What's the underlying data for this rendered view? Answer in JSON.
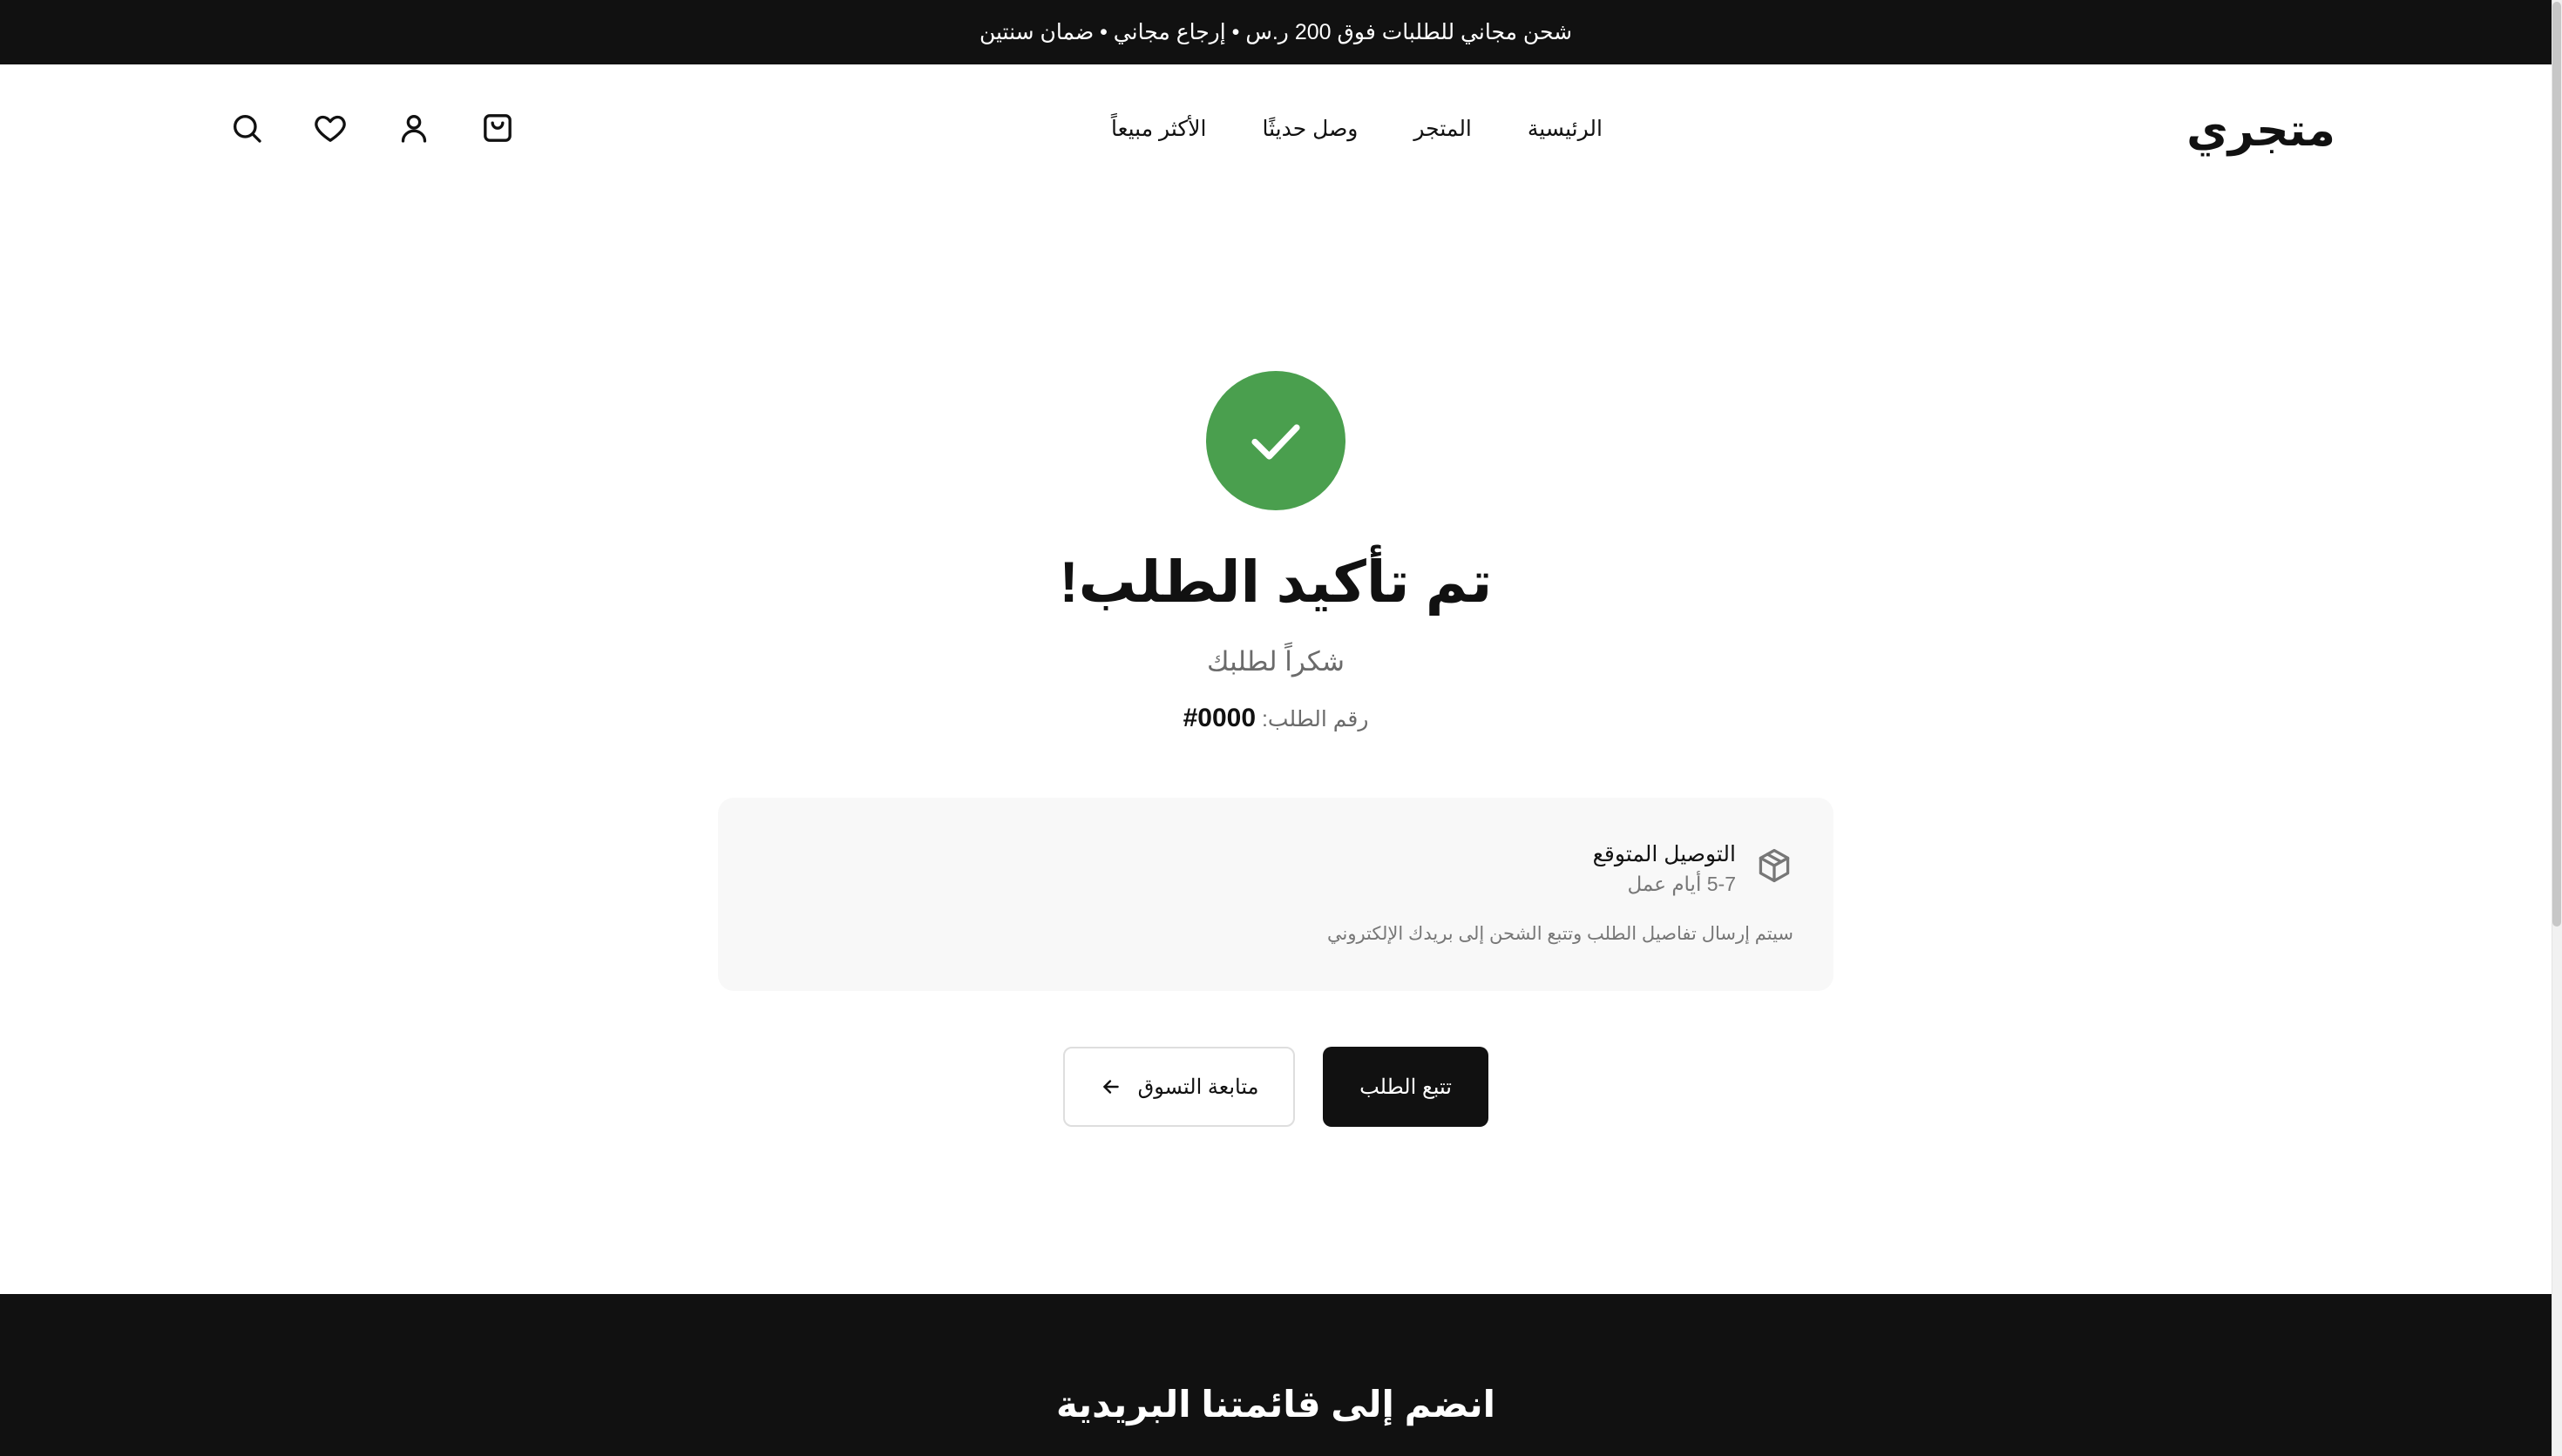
{
  "announcement": {
    "text": "شحن مجاني للطلبات فوق 200 ر.س • إرجاع مجاني • ضمان سنتين"
  },
  "header": {
    "logo": "متجري",
    "nav": [
      {
        "label": "الرئيسية"
      },
      {
        "label": "المتجر"
      },
      {
        "label": "وصل حديثًا"
      },
      {
        "label": "الأكثر مبيعاً"
      }
    ],
    "icons": [
      "search-icon",
      "heart-icon",
      "user-icon",
      "shopping-bag-icon"
    ]
  },
  "confirmation": {
    "title": "تم تأكيد الطلب!",
    "subtitle": "شكراً لطلبك",
    "order_label": "رقم الطلب:",
    "order_number": "#0000",
    "success_color": "#4a9f4e"
  },
  "delivery": {
    "title": "التوصيل المتوقع",
    "days": "5-7 أيام عمل",
    "note": "سيتم إرسال تفاصيل الطلب وتتبع الشحن إلى بريدك الإلكتروني"
  },
  "actions": {
    "track_label": "تتبع الطلب",
    "continue_label": "متابعة التسوق"
  },
  "footer": {
    "newsletter_title": "انضم إلى قائمتنا البريدية"
  }
}
